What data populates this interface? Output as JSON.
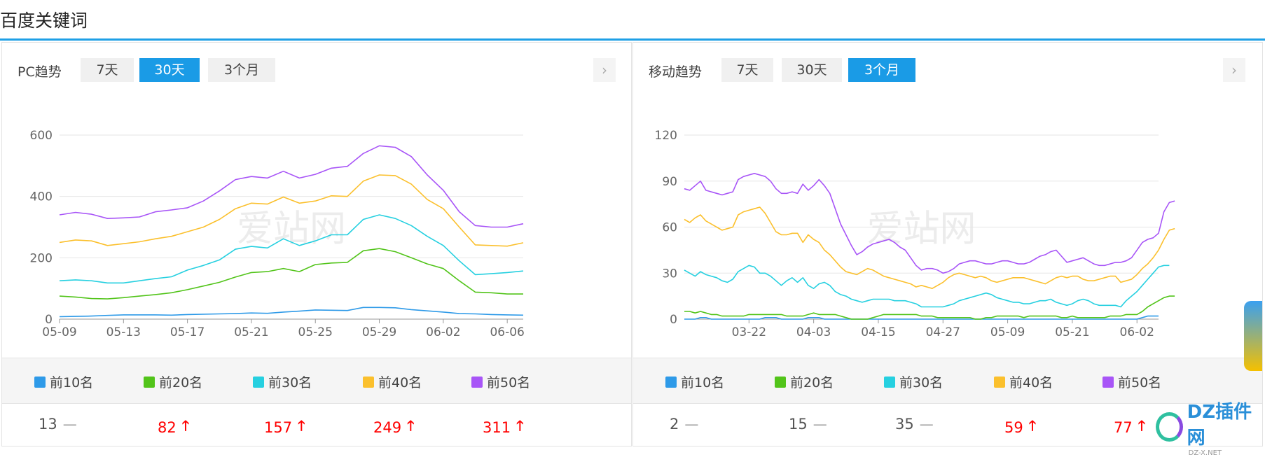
{
  "page": {
    "title": "百度关键词"
  },
  "pc": {
    "label": "PC趋势",
    "tabs": [
      "7天",
      "30天",
      "3个月"
    ],
    "active_tab": 1,
    "legend": [
      {
        "label": "前10名",
        "color": "#2e9ae8"
      },
      {
        "label": "前20名",
        "color": "#52c41a"
      },
      {
        "label": "前30名",
        "color": "#26d0e0"
      },
      {
        "label": "前40名",
        "color": "#fbc02d"
      },
      {
        "label": "前50名",
        "color": "#a855f7"
      }
    ],
    "values": [
      {
        "num": "13",
        "trend": "flat",
        "symbol": "—"
      },
      {
        "num": "82",
        "trend": "up",
        "symbol": "🡑"
      },
      {
        "num": "157",
        "trend": "up",
        "symbol": "🡑"
      },
      {
        "num": "249",
        "trend": "up",
        "symbol": "🡑"
      },
      {
        "num": "311",
        "trend": "up",
        "symbol": "🡑"
      }
    ]
  },
  "mobile": {
    "label": "移动趋势",
    "tabs": [
      "7天",
      "30天",
      "3个月"
    ],
    "active_tab": 2,
    "legend": [
      {
        "label": "前10名",
        "color": "#2e9ae8"
      },
      {
        "label": "前20名",
        "color": "#52c41a"
      },
      {
        "label": "前30名",
        "color": "#26d0e0"
      },
      {
        "label": "前40名",
        "color": "#fbc02d"
      },
      {
        "label": "前50名",
        "color": "#a855f7"
      }
    ],
    "values": [
      {
        "num": "2",
        "trend": "flat",
        "symbol": "—"
      },
      {
        "num": "15",
        "trend": "flat",
        "symbol": "—"
      },
      {
        "num": "35",
        "trend": "flat",
        "symbol": "—"
      },
      {
        "num": "59",
        "trend": "up",
        "symbol": "🡑"
      },
      {
        "num": "77",
        "trend": "up",
        "symbol": "🡑"
      }
    ]
  },
  "watermark": {
    "text": "爱站网",
    "logo_text": "DZ插件网",
    "logo_sub": "DZ-X.NET"
  },
  "chart_data": [
    {
      "type": "line",
      "ylim": [
        0,
        600
      ],
      "yticks": [
        0,
        200,
        400,
        600
      ],
      "xtick_labels": [
        "05-09",
        "05-13",
        "05-17",
        "05-21",
        "05-25",
        "05-29",
        "06-02",
        "06-06"
      ],
      "xtick_index": [
        0,
        4,
        8,
        12,
        16,
        20,
        24,
        28
      ],
      "grid": true,
      "x": [
        "05-09",
        "05-10",
        "05-11",
        "05-12",
        "05-13",
        "05-14",
        "05-15",
        "05-16",
        "05-17",
        "05-18",
        "05-19",
        "05-20",
        "05-21",
        "05-22",
        "05-23",
        "05-24",
        "05-25",
        "05-26",
        "05-27",
        "05-28",
        "05-29",
        "05-30",
        "05-31",
        "06-01",
        "06-02",
        "06-03",
        "06-04",
        "06-05",
        "06-06",
        "06-07"
      ],
      "series": [
        {
          "name": "前10名",
          "color": "#2e9ae8",
          "values": [
            8,
            9,
            10,
            12,
            14,
            14,
            14,
            13,
            15,
            16,
            17,
            18,
            20,
            19,
            23,
            26,
            30,
            29,
            28,
            38,
            38,
            37,
            31,
            27,
            23,
            18,
            17,
            15,
            14,
            13
          ]
        },
        {
          "name": "前20名",
          "color": "#52c41a",
          "values": [
            75,
            72,
            67,
            66,
            70,
            75,
            80,
            86,
            96,
            108,
            120,
            137,
            152,
            155,
            165,
            155,
            178,
            183,
            185,
            223,
            230,
            220,
            200,
            180,
            165,
            125,
            88,
            86,
            82,
            82
          ]
        },
        {
          "name": "前30名",
          "color": "#26d0e0",
          "values": [
            125,
            128,
            125,
            118,
            118,
            125,
            132,
            138,
            160,
            175,
            193,
            228,
            237,
            232,
            262,
            240,
            255,
            275,
            275,
            325,
            340,
            328,
            305,
            270,
            240,
            190,
            145,
            148,
            152,
            157
          ]
        },
        {
          "name": "前40名",
          "color": "#fbc02d",
          "values": [
            250,
            258,
            255,
            240,
            246,
            252,
            262,
            270,
            285,
            300,
            325,
            360,
            378,
            375,
            398,
            378,
            385,
            402,
            400,
            450,
            470,
            468,
            440,
            390,
            360,
            300,
            242,
            240,
            238,
            249
          ]
        },
        {
          "name": "前50名",
          "color": "#a855f7",
          "values": [
            340,
            348,
            342,
            328,
            330,
            333,
            350,
            356,
            363,
            385,
            418,
            455,
            465,
            460,
            482,
            460,
            472,
            492,
            498,
            540,
            565,
            560,
            530,
            470,
            420,
            350,
            305,
            300,
            300,
            311
          ]
        }
      ]
    },
    {
      "type": "line",
      "ylim": [
        0,
        120
      ],
      "yticks": [
        0,
        30,
        60,
        90,
        120
      ],
      "xtick_labels": [
        "03-22",
        "04-03",
        "04-15",
        "04-27",
        "05-09",
        "05-21",
        "06-02"
      ],
      "xtick_index": [
        12,
        24,
        36,
        48,
        60,
        72,
        84
      ],
      "grid": true,
      "series": [
        {
          "name": "前10名",
          "color": "#2e9ae8",
          "values": [
            0,
            0,
            0,
            1,
            1,
            0,
            0,
            0,
            0,
            0,
            0,
            0,
            0,
            0,
            0,
            1,
            1,
            1,
            0,
            0,
            0,
            0,
            0,
            1,
            1,
            1,
            0,
            0,
            0,
            0,
            0,
            0,
            0,
            0,
            0,
            0,
            0,
            0,
            0,
            0,
            0,
            0,
            0,
            0,
            0,
            0,
            0,
            0,
            0,
            0,
            0,
            0,
            0,
            0,
            0,
            0,
            0,
            0,
            0,
            0,
            0,
            0,
            0,
            0,
            0,
            0,
            0,
            0,
            0,
            0,
            0,
            0,
            0,
            0,
            0,
            0,
            0,
            0,
            0,
            0,
            0,
            0,
            0,
            0,
            0,
            1,
            2,
            2,
            2
          ]
        },
        {
          "name": "前20名",
          "color": "#52c41a",
          "values": [
            5,
            5,
            4,
            5,
            4,
            3,
            3,
            2,
            2,
            2,
            2,
            2,
            3,
            3,
            3,
            3,
            3,
            3,
            3,
            2,
            2,
            2,
            2,
            3,
            4,
            3,
            3,
            3,
            3,
            2,
            1,
            0,
            0,
            0,
            0,
            1,
            2,
            3,
            3,
            3,
            3,
            3,
            3,
            3,
            2,
            2,
            2,
            1,
            1,
            1,
            1,
            1,
            1,
            1,
            0,
            0,
            1,
            1,
            2,
            2,
            2,
            2,
            2,
            1,
            2,
            2,
            2,
            2,
            2,
            2,
            1,
            1,
            2,
            1,
            1,
            1,
            1,
            1,
            1,
            2,
            2,
            2,
            3,
            3,
            3,
            5,
            8,
            10,
            12,
            14,
            15,
            15
          ]
        },
        {
          "name": "前30名",
          "color": "#26d0e0",
          "values": [
            32,
            30,
            28,
            31,
            29,
            28,
            27,
            25,
            24,
            26,
            31,
            33,
            35,
            34,
            30,
            30,
            28,
            25,
            22,
            25,
            27,
            24,
            27,
            22,
            20,
            23,
            24,
            22,
            18,
            16,
            15,
            13,
            12,
            11,
            12,
            13,
            13,
            13,
            13,
            12,
            12,
            12,
            11,
            10,
            8,
            8,
            8,
            8,
            8,
            9,
            10,
            12,
            13,
            14,
            15,
            16,
            17,
            16,
            14,
            13,
            12,
            11,
            11,
            10,
            10,
            11,
            12,
            12,
            13,
            11,
            10,
            9,
            10,
            12,
            13,
            12,
            10,
            9,
            9,
            9,
            9,
            8,
            12,
            15,
            18,
            22,
            26,
            30,
            34,
            35,
            35
          ]
        },
        {
          "name": "前40名",
          "color": "#fbc02d",
          "values": [
            65,
            63,
            66,
            68,
            64,
            62,
            60,
            58,
            59,
            60,
            68,
            70,
            71,
            72,
            73,
            69,
            63,
            57,
            55,
            55,
            56,
            56,
            50,
            55,
            52,
            50,
            45,
            42,
            38,
            34,
            31,
            30,
            29,
            31,
            33,
            32,
            30,
            28,
            27,
            26,
            25,
            24,
            23,
            21,
            22,
            21,
            20,
            22,
            24,
            27,
            29,
            30,
            29,
            28,
            27,
            28,
            27,
            25,
            24,
            25,
            26,
            27,
            27,
            27,
            26,
            25,
            24,
            23,
            25,
            27,
            28,
            27,
            28,
            28,
            26,
            25,
            25,
            26,
            27,
            28,
            28,
            24,
            25,
            26,
            29,
            33,
            36,
            40,
            45,
            52,
            58,
            59
          ]
        },
        {
          "name": "前50名",
          "color": "#a855f7",
          "values": [
            85,
            84,
            87,
            90,
            84,
            83,
            82,
            81,
            82,
            83,
            91,
            93,
            94,
            95,
            94,
            93,
            90,
            85,
            82,
            82,
            83,
            82,
            88,
            84,
            87,
            91,
            87,
            82,
            72,
            62,
            55,
            48,
            42,
            44,
            47,
            49,
            50,
            51,
            52,
            50,
            47,
            45,
            40,
            35,
            32,
            33,
            33,
            32,
            30,
            31,
            33,
            36,
            37,
            38,
            38,
            37,
            36,
            36,
            37,
            38,
            38,
            37,
            36,
            36,
            37,
            39,
            41,
            42,
            44,
            45,
            41,
            37,
            38,
            39,
            40,
            38,
            36,
            35,
            35,
            36,
            37,
            37,
            38,
            40,
            45,
            50,
            52,
            53,
            56,
            70,
            76,
            77
          ]
        }
      ]
    }
  ]
}
